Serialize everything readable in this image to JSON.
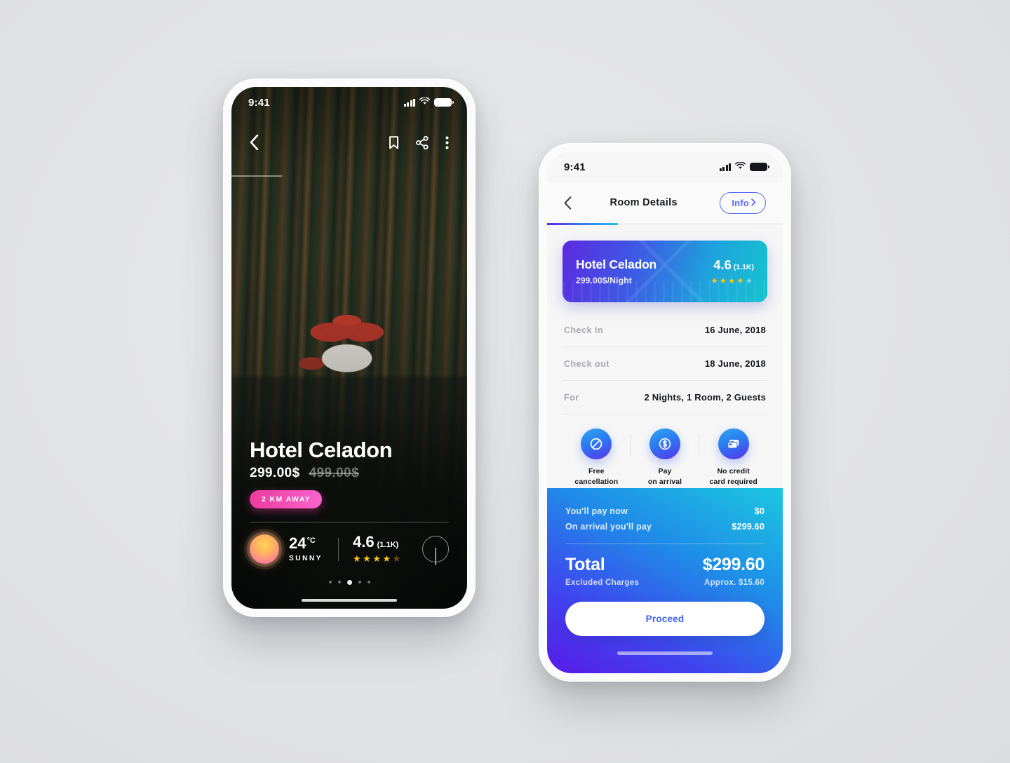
{
  "scene": {
    "background_color": "#e3e4e6"
  },
  "phone_one": {
    "name": "hotel-photo-screen",
    "status_bar": {
      "time": "9:41",
      "signal": "signal-bars-icon",
      "wifi": "wifi-icon",
      "battery": "battery-full-icon"
    },
    "nav": {
      "back": "chevron-left-icon",
      "bookmark": "bookmark-icon",
      "share": "share-icon",
      "more": "more-vertical-icon"
    },
    "hotel_name": "Hotel Celadon",
    "price_current": "299.00$",
    "price_original": "499.00$",
    "distance_badge": "2 KM AWAY",
    "weather": {
      "icon": "sun-icon",
      "temperature": "24",
      "unit": "°C",
      "condition": "SUNNY"
    },
    "rating": {
      "score": "4.6",
      "count": "(1.1K)",
      "stars_filled": 4,
      "stars_total": 5
    },
    "location_icon": "location-pin-icon",
    "pagination": {
      "total": 5,
      "active_index": 2
    }
  },
  "phone_two": {
    "name": "room-details-screen",
    "status_bar": {
      "time": "9:41",
      "signal": "signal-bars-icon",
      "wifi": "wifi-icon",
      "battery": "battery-full-icon"
    },
    "header": {
      "back": "chevron-left-icon",
      "title": "Room Details",
      "info_label": "Info",
      "info_chevron": "chevron-right-icon",
      "accent_color": "#5a6cf6"
    },
    "progress": {
      "percent": 30,
      "gradient_from": "#5d27e8",
      "gradient_to": "#1cc7e6"
    },
    "hotel_card": {
      "name": "Hotel Celadon",
      "price": "299.00$/Night",
      "score": "4.6",
      "count": "(1.1K)",
      "stars_filled": 4,
      "stars_total": 5,
      "gradient_from": "#5c2ae0",
      "gradient_to": "#16c3cf"
    },
    "details": [
      {
        "key": "Check in",
        "value": "16 June, 2018"
      },
      {
        "key": "Check out",
        "value": "18 June, 2018"
      },
      {
        "key": "For",
        "value": "2 Nights, 1 Room,  2 Guests"
      }
    ],
    "perks": [
      {
        "icon": "no-entry-icon",
        "line1": "Free",
        "line2": "cancellation"
      },
      {
        "icon": "dollar-coin-icon",
        "line1": "Pay",
        "line2": "on arrival"
      },
      {
        "icon": "credit-card-icon",
        "line1": "No credit",
        "line2": "card required"
      }
    ],
    "payment": {
      "pay_now_label": "You'll pay now",
      "pay_now_value": "$0",
      "on_arrival_label": "On arrival you'll pay",
      "on_arrival_value": "$299.60",
      "total_label": "Total",
      "total_sub": "Excluded Charges",
      "total_value": "$299.60",
      "total_approx": "Approx. $15.60",
      "gradient_from": "#5a1ae8",
      "gradient_to": "#1bc8e0"
    },
    "proceed_label": "Proceed"
  }
}
